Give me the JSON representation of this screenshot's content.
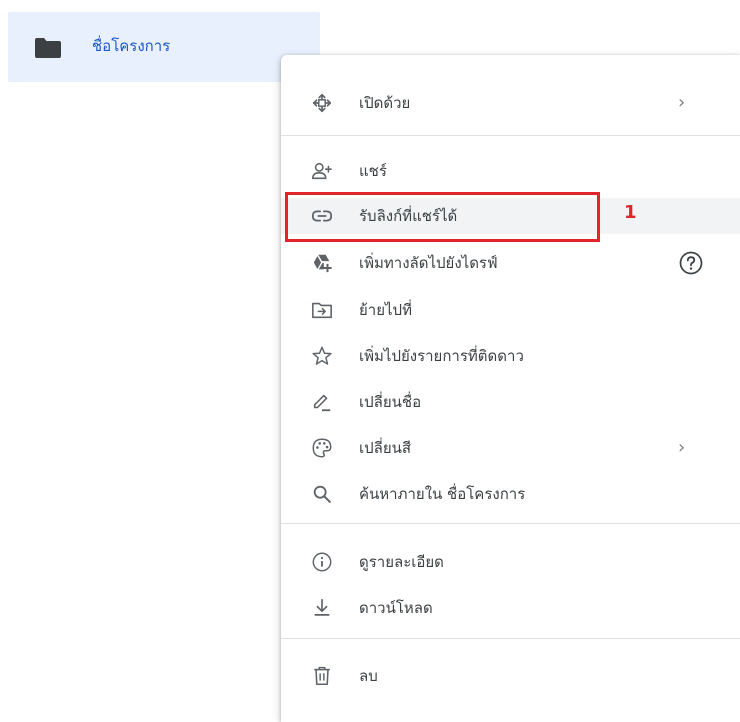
{
  "folder": {
    "name": "ชื่อโครงการ",
    "icon": "folder-icon"
  },
  "menu": {
    "open_with": {
      "label": "เปิดด้วย",
      "icon": "move-arrows-icon",
      "has_submenu": true
    },
    "share": {
      "label": "แชร์",
      "icon": "person-add-icon"
    },
    "get_link": {
      "label": "รับลิงก์ที่แชร์ได้",
      "icon": "link-icon"
    },
    "add_shortcut": {
      "label": "เพิ่มทางลัดไปยังไดรฟ์",
      "icon": "drive-add-icon",
      "help_icon": "help-circle-icon"
    },
    "move_to": {
      "label": "ย้ายไปที่",
      "icon": "folder-move-icon"
    },
    "add_starred": {
      "label": "เพิ่มไปยังรายการที่ติดดาว",
      "icon": "star-outline-icon"
    },
    "rename": {
      "label": "เปลี่ยนชื่อ",
      "icon": "pencil-icon"
    },
    "change_color": {
      "label": "เปลี่ยนสี",
      "icon": "palette-icon",
      "has_submenu": true
    },
    "search_within": {
      "label": "ค้นหาภายใน ชื่อโครงการ",
      "icon": "search-icon"
    },
    "view_details": {
      "label": "ดูรายละเอียด",
      "icon": "info-icon"
    },
    "download": {
      "label": "ดาวน์โหลด",
      "icon": "download-icon"
    },
    "remove": {
      "label": "ลบ",
      "icon": "trash-icon"
    }
  },
  "chevron": "›",
  "annotation": {
    "number": "1",
    "color": "#e0252b"
  },
  "colors": {
    "folder_selected_bg": "#e8f0fe",
    "folder_label": "#1a57c8",
    "menu_text": "#3c4043",
    "icon": "#5f6368",
    "hover_bg": "#f1f3f4"
  }
}
